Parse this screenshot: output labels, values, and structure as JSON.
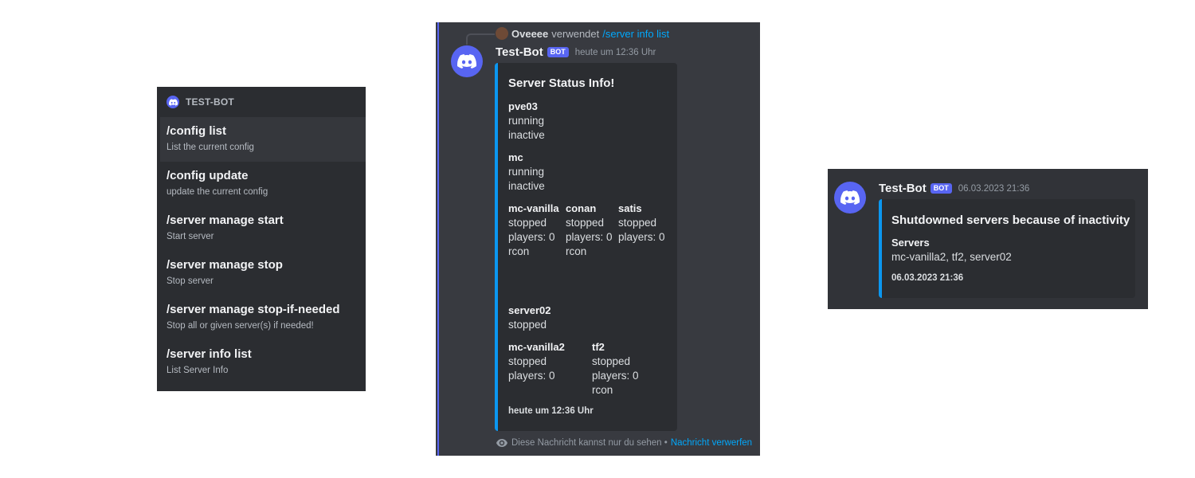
{
  "command_panel": {
    "bot_name": "TEST-BOT",
    "commands": [
      {
        "name": "/config list",
        "description": "List the current config"
      },
      {
        "name": "/config update",
        "description": "update the current config"
      },
      {
        "name": "/server manage start",
        "description": "Start server"
      },
      {
        "name": "/server manage stop",
        "description": "Stop server"
      },
      {
        "name": "/server manage stop-if-needed",
        "description": "Stop all or given server(s) if needed!"
      },
      {
        "name": "/server info list",
        "description": "List Server Info"
      }
    ]
  },
  "info_message": {
    "reply": {
      "user": "Oveeee",
      "verb": "verwendet",
      "command": "/server info list"
    },
    "author": "Test-Bot",
    "bot_tag": "BOT",
    "timestamp": "heute um 12:36 Uhr",
    "embed": {
      "title": "Server Status Info!",
      "fields": [
        {
          "name": "pve03",
          "lines": [
            "running",
            "inactive"
          ]
        },
        {
          "name": "mc",
          "lines": [
            "running",
            "inactive"
          ]
        },
        {
          "name": "mc-vanilla",
          "lines": [
            "stopped",
            "players: 0",
            "rcon"
          ]
        },
        {
          "name": "conan",
          "lines": [
            "stopped",
            "players: 0",
            "rcon"
          ]
        },
        {
          "name": "satis",
          "lines": [
            "stopped",
            "players: 0"
          ]
        },
        {
          "name": "server02",
          "lines": [
            "stopped"
          ]
        },
        {
          "name": "mc-vanilla2",
          "lines": [
            "stopped",
            "players: 0"
          ]
        },
        {
          "name": "tf2",
          "lines": [
            "stopped",
            "players: 0",
            "rcon"
          ]
        }
      ],
      "footer": "heute um 12:36 Uhr"
    },
    "ephemeral_note": "Diese Nachricht kannst nur du sehen •",
    "dismiss_link": "Nachricht verwerfen"
  },
  "shutdown_message": {
    "author": "Test-Bot",
    "bot_tag": "BOT",
    "timestamp": "06.03.2023 21:36",
    "embed": {
      "title": "Shutdowned servers because of inactivity",
      "field_name": "Servers",
      "field_value": "mc-vanilla2, tf2, server02",
      "footer": "06.03.2023 21:36"
    }
  },
  "colors": {
    "blurple": "#5865f2",
    "embed_border": "#0b97f0",
    "link": "#00a8fc"
  },
  "icons": [
    "discord-logo-icon",
    "eye-icon"
  ]
}
